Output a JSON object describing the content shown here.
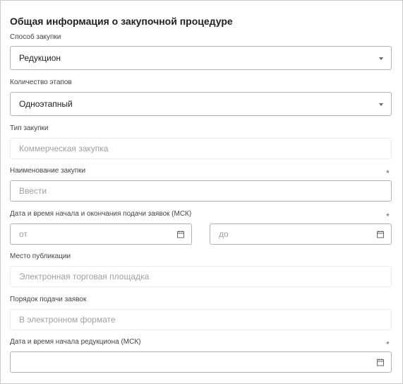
{
  "form": {
    "title": "Общая информация о закупочной процедуре",
    "method": {
      "label": "Способ закупки",
      "value": "Редукцион",
      "icon": "chevron-down-icon"
    },
    "stages": {
      "label": "Количество этапов",
      "value": "Одноэтапный",
      "icon": "chevron-down-icon"
    },
    "type": {
      "label": "Тип закупки",
      "placeholder": "Коммерческая закупка"
    },
    "name": {
      "label": "Наименование закупки",
      "placeholder": "Ввести",
      "required": "*"
    },
    "dates": {
      "label": "Дата и время начала и окончания подачи заявок (МСК)",
      "from_placeholder": "от",
      "to_placeholder": "до",
      "required": "*",
      "icon": "calendar-icon"
    },
    "place": {
      "label": "Место публикации",
      "placeholder": "Электронная торговая площадка"
    },
    "order": {
      "label": "Порядок подачи заявок",
      "placeholder": "В электронном формате"
    },
    "reduction_start": {
      "label": "Дата и время начала редукциона (МСК)",
      "required": "*",
      "icon": "calendar-icon"
    }
  }
}
